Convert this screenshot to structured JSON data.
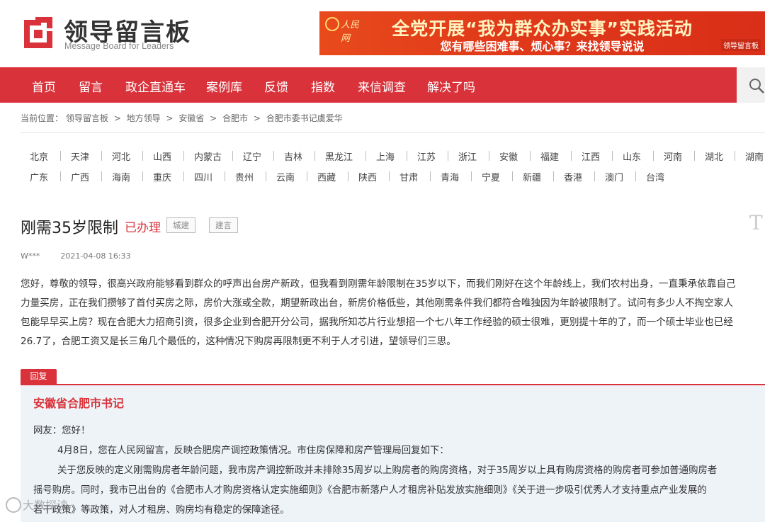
{
  "header": {
    "logo_cn": "领导留言板",
    "logo_en": "Message Board for Leaders",
    "banner_emblem": "人民网",
    "banner_title": "全党开展“我为群众办实事”实践活动",
    "banner_subtitle": "您有哪些困难事、烦心事？来找领导说说",
    "banner_tag": "领导留言板"
  },
  "nav": {
    "items": [
      "首页",
      "留言",
      "政企直通车",
      "案例库",
      "反馈",
      "指数",
      "来信调查",
      "解决了吗"
    ]
  },
  "breadcrumb": {
    "items": [
      "当前位置：",
      "领导留言板",
      "地方领导",
      "安徽省",
      "合肥市",
      "合肥市委书记虞爱华"
    ],
    "separator": ">"
  },
  "provinces": {
    "row1": [
      "北京",
      "天津",
      "河北",
      "山西",
      "内蒙古",
      "辽宁",
      "吉林",
      "黑龙江",
      "上海",
      "江苏",
      "浙江",
      "安徽",
      "福建",
      "江西",
      "山东",
      "河南",
      "湖北",
      "湖南"
    ],
    "row2": [
      "广东",
      "广西",
      "海南",
      "重庆",
      "四川",
      "贵州",
      "云南",
      "西藏",
      "陕西",
      "甘肃",
      "青海",
      "宁夏",
      "新疆",
      "香港",
      "澳门",
      "台湾"
    ]
  },
  "post": {
    "title": "刚需35岁限制",
    "status": "已办理",
    "tags": [
      "城建",
      "建言"
    ],
    "author": "W***",
    "date": "2021-04-08 16:33",
    "side_letter": "T",
    "content_lines": [
      "您好，尊敬的领导，很高兴政府能够看到群众的呼声出台房产新政，但我看到刚需年龄限制在35岁以下，而我们刚好在这个年龄线上，我们农村出身，一直秉承依靠自己",
      "力量买房，正在我们攒够了首付买房之际，房价大涨或全款，期望新政出台，新房价格低些，其他刚需条件我们都符合唯独因为年龄被限制了。试问有多少人不掏空家人",
      "包能早早买上房？现在合肥大力招商引资，很多企业到合肥开分公司，据我所知芯片行业想招一个七八年工作经验的硕士很难，更别提十年的了，而一个硕士毕业也已经",
      "26.7了，合肥工资又是长三角几个最低的，这种情况下购房再限制更不利于人才引进，望领导们三思。"
    ]
  },
  "reply": {
    "label": "回复",
    "org": "安徽省合肥市书记",
    "lines": [
      "网友：您好！",
      "4月8日，您在人民网留言，反映合肥房产调控政策情况。市住房保障和房产管理局回复如下：",
      "关于您反映的定义刚需购房者年龄问题，我市房产调控新政并未排除35周岁以上购房者的购房资格，对于35周岁以上具有购房资格的购房者可参加普通购房者",
      "摇号购房。同时，我市已出台的《合肥市人才购房资格认定实施细则》《合肥市新落户人才租房补贴发放实施细则》《关于进一步吸引优秀人才支持重点产业发展的",
      "若干政策》等政策，对人才租房、购房均有稳定的保障途径。"
    ]
  },
  "watermark": "大数探读",
  "colors": {
    "brand_red": "#d9323a",
    "banner_orange": "#e03a1a",
    "reply_bg": "#eef3f8"
  }
}
